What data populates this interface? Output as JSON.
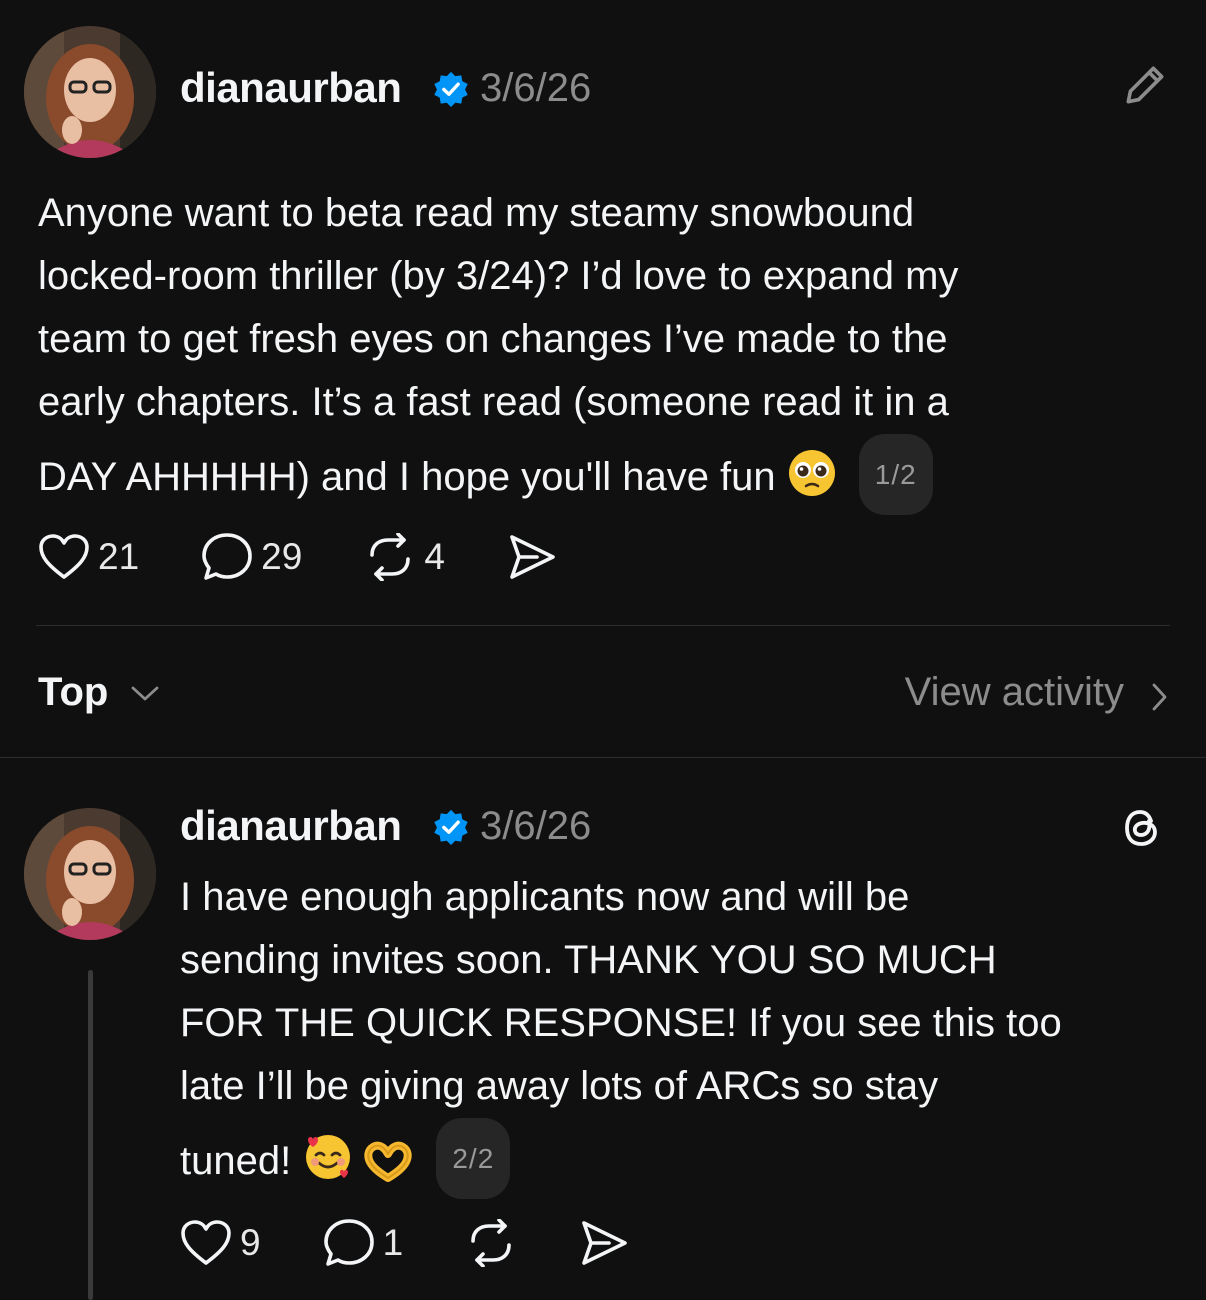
{
  "post1": {
    "username": "dianaurban",
    "date": "3/6/26",
    "text": "Anyone want to beta read my steamy snowbound\nlocked-room thriller (by 3/24)? I’d love to expand my\nteam to get fresh eyes on changes I’ve made to the\nearly chapters. It’s a fast read (someone read it in a\nDAY AHHHHH) and I hope you'll have fun",
    "page_badge": "1/2",
    "like_count": "21",
    "reply_count": "29",
    "repost_count": "4",
    "header_icon": "pencil-icon"
  },
  "sort": {
    "label": "Top",
    "view_activity": "View activity"
  },
  "post2": {
    "username": "dianaurban",
    "date": "3/6/26",
    "text": "I have enough applicants now and will be\nsending invites soon. THANK YOU SO MUCH\nFOR THE QUICK RESPONSE! If you see this too\nlate I’ll be giving away lots of ARCs so stay\ntuned!",
    "page_badge": "2/2",
    "like_count": "9",
    "reply_count": "1",
    "header_icon": "threads-logo-icon"
  },
  "colors": {
    "background": "#101010",
    "text": "#f3f5f7",
    "secondary": "#8c8c8c",
    "verified": "#0095f6"
  }
}
